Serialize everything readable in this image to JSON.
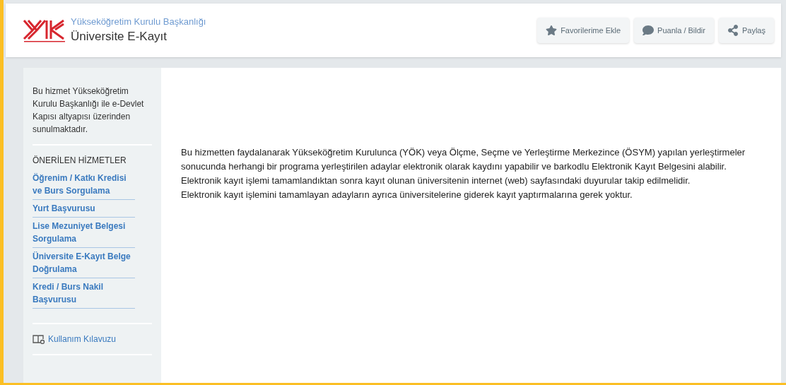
{
  "header": {
    "organization": "Yükseköğretim Kurulu Başkanlığı",
    "title": "Üniversite E-Kayıt",
    "actions": [
      {
        "kind": "favorite",
        "label": "Favorilerime Ekle"
      },
      {
        "kind": "rate",
        "label": "Puanla / Bildir"
      },
      {
        "kind": "share",
        "label": "Paylaş"
      }
    ]
  },
  "sidebar": {
    "note": "Bu hizmet Yükseköğretim Kurulu Başkanlığı ile e-Devlet Kapısı altyapısı üzerinden sunulmaktadır.",
    "services_heading": "ÖNERİLEN HİZMETLER",
    "services": [
      "Öğrenim / Katkı Kredisi ve Burs Sorgulama",
      "Yurt Başvurusu",
      "Lise Mezuniyet Belgesi Sorgulama",
      "Üniversite E-Kayıt Belge Doğrulama",
      "Kredi / Burs Nakil Başvurusu"
    ],
    "guide": "Kullanım Kılavuzu"
  },
  "content": {
    "paragraphs": [
      "Bu hizmetten faydalanarak Yükseköğretim Kurulunca (YÖK) veya Ölçme, Seçme ve Yerleştirme Merkezince (ÖSYM) yapılan yerleştirmeler sonucunda herhangi bir programa yerleştirilen adaylar elektronik olarak kaydını yapabilir ve barkodlu Elektronik Kayıt Belgesini alabilir.",
      "Elektronik kayıt işlemi tamamlandıktan sonra kayıt olunan üniversitenin internet (web) sayfasındaki duyurular takip edilmelidir.",
      "Elektronik kayıt işlemini tamamlayan adayların ayrıca üniversitelerine giderek kayıt yaptırmalarına gerek yoktur."
    ]
  }
}
